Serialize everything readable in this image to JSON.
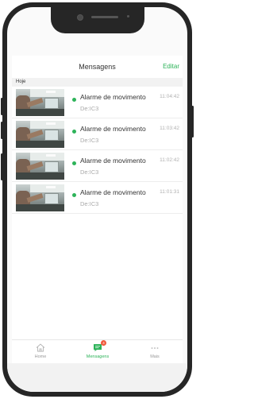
{
  "header": {
    "title": "Mensagens",
    "edit_label": "Editar"
  },
  "section": {
    "label": "Hoje"
  },
  "messages": [
    {
      "title": "Alarme de movimento",
      "source": "De:IC3",
      "time": "11:04:42",
      "unread": true
    },
    {
      "title": "Alarme de movimento",
      "source": "De:IC3",
      "time": "11:03:42",
      "unread": true
    },
    {
      "title": "Alarme de movimento",
      "source": "De:IC3",
      "time": "11:02:42",
      "unread": true
    },
    {
      "title": "Alarme de movimento",
      "source": "De:IC3",
      "time": "11:01:31",
      "unread": true
    }
  ],
  "tabs": [
    {
      "label": "Home",
      "icon": "home-icon",
      "active": false
    },
    {
      "label": "Mensagens",
      "icon": "message-icon",
      "active": true,
      "badge": "4"
    },
    {
      "label": "Mais",
      "icon": "more-icon",
      "active": false
    }
  ],
  "colors": {
    "accent": "#2db359",
    "badge": "#f05a3c"
  }
}
